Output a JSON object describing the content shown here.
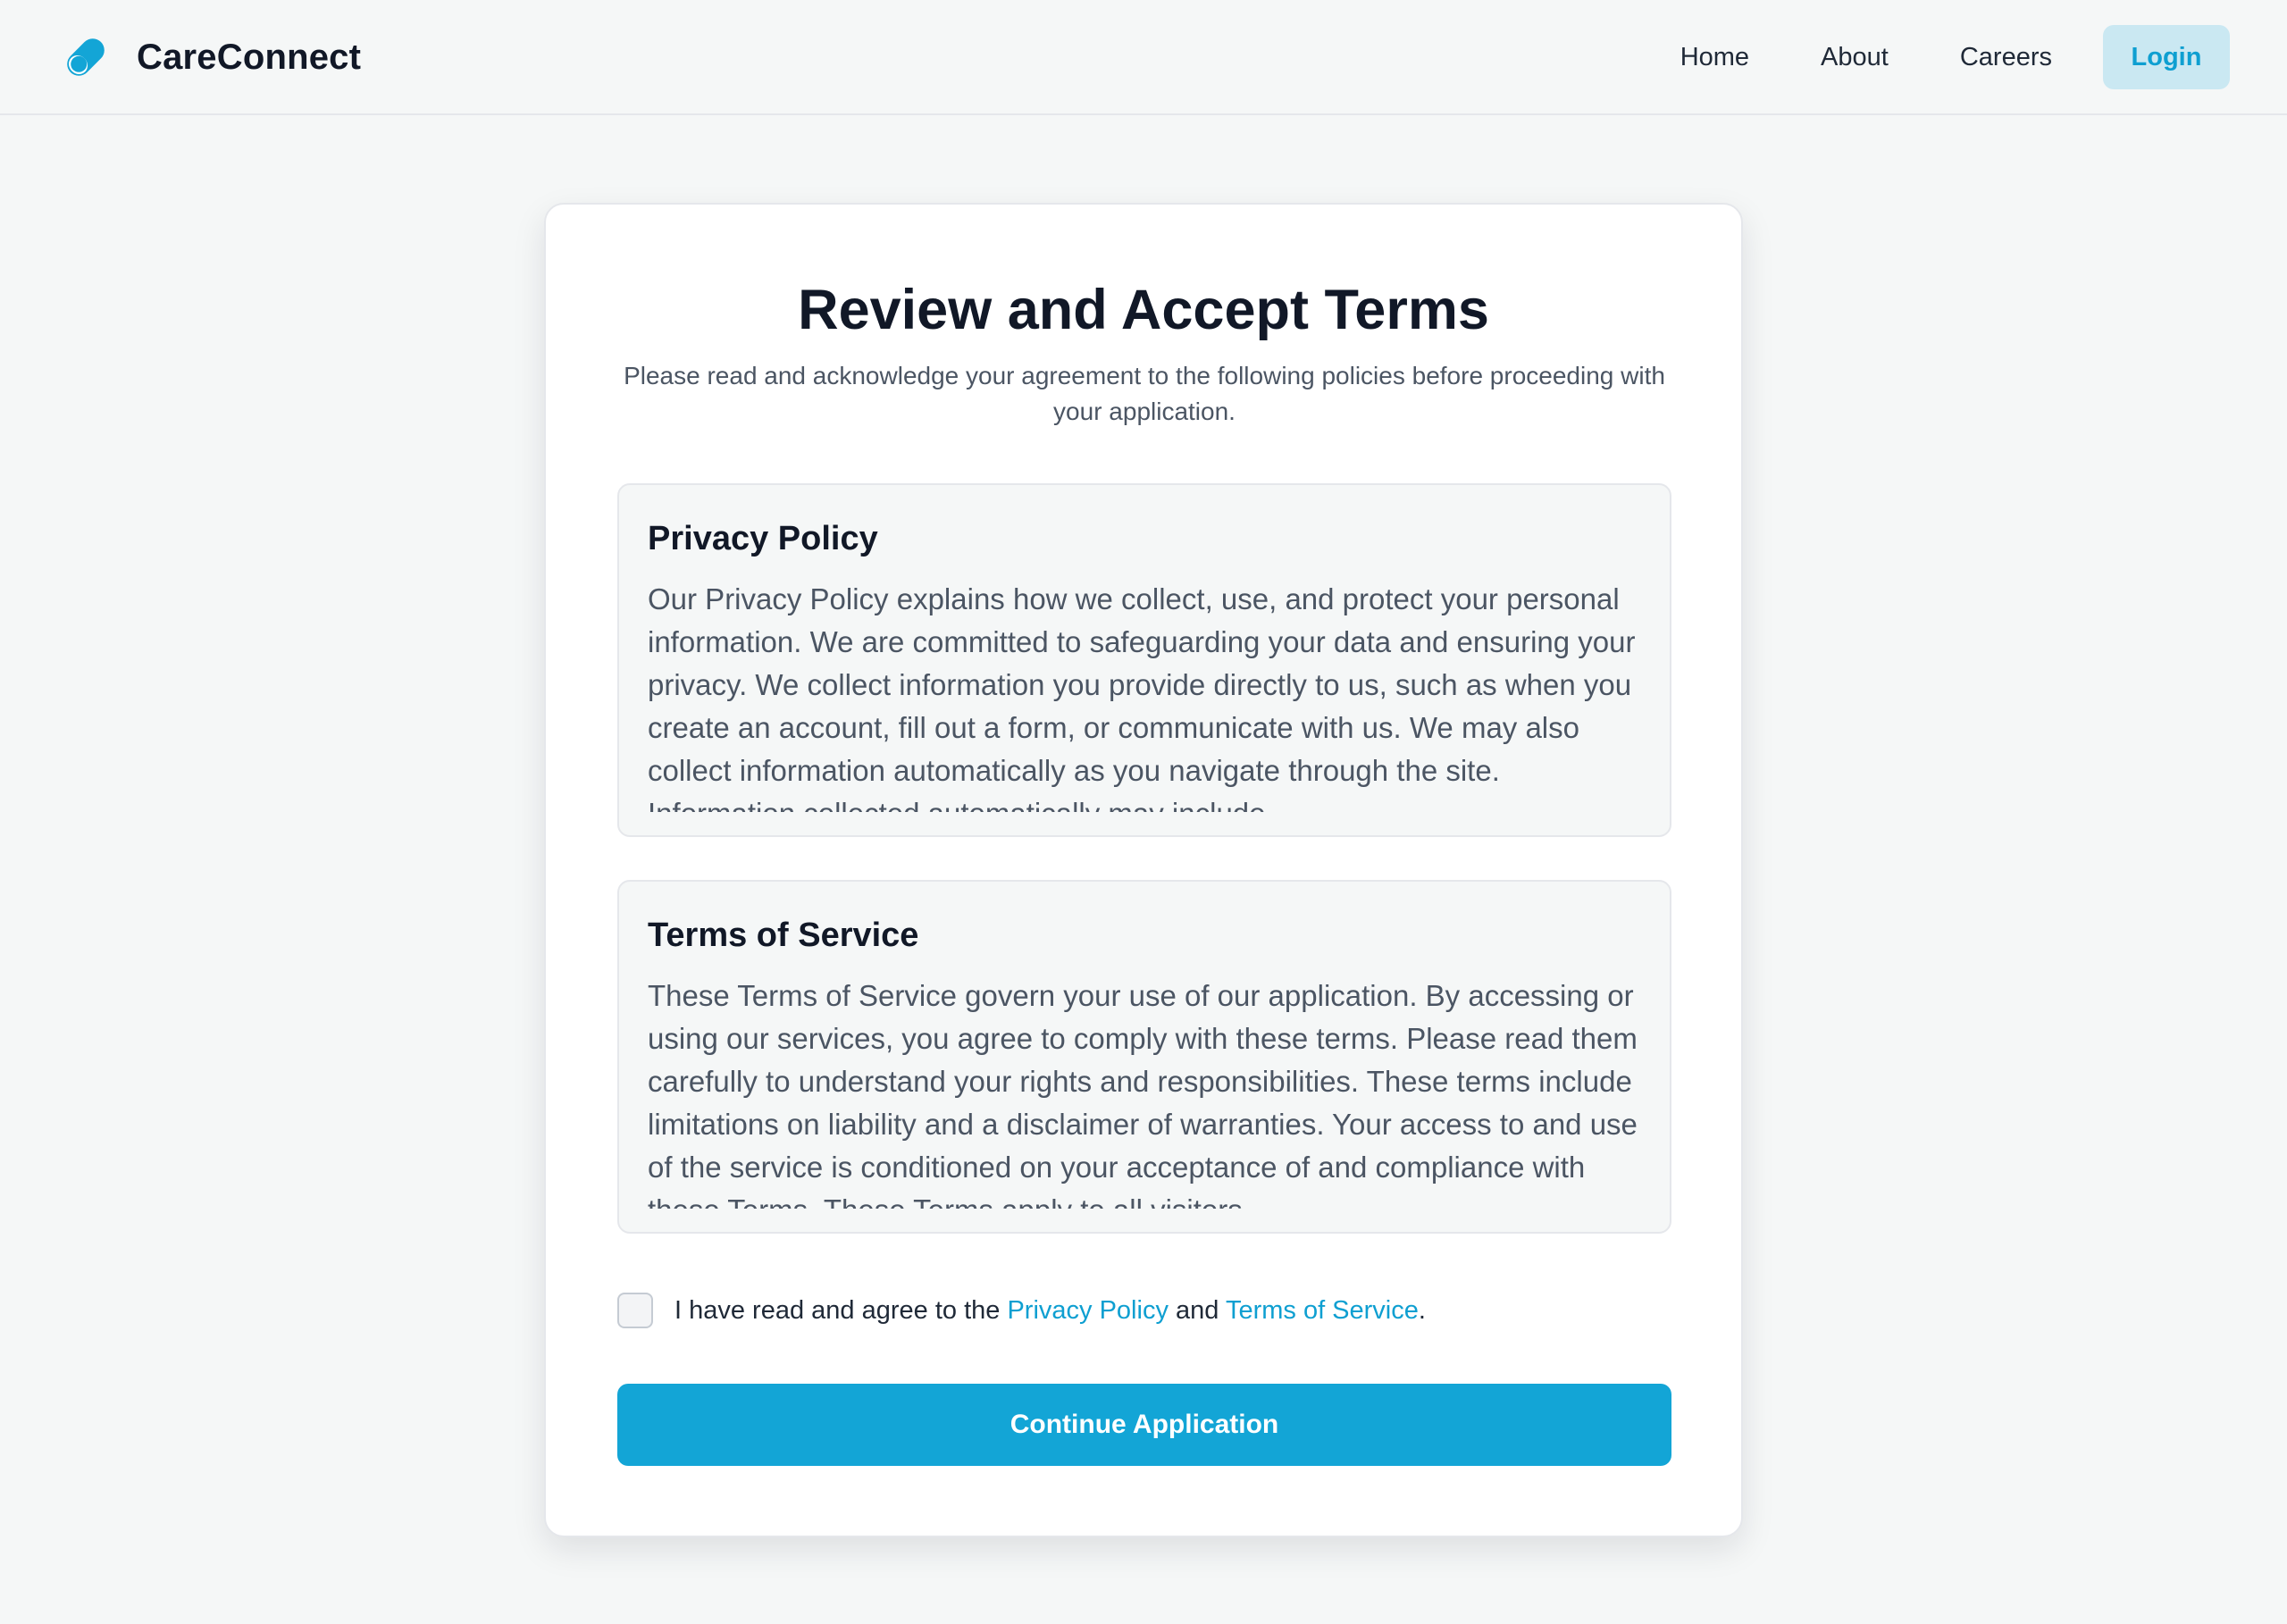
{
  "header": {
    "brand_name": "CareConnect",
    "brand_icon": "pill-logo-icon",
    "nav": [
      "Home",
      "About",
      "Careers"
    ],
    "login_label": "Login"
  },
  "main": {
    "title": "Review and Accept Terms",
    "subtitle": "Please read and acknowledge your agreement to the following policies before proceeding with your application.",
    "privacy": {
      "title": "Privacy Policy",
      "body": "Our Privacy Policy explains how we collect, use, and protect your personal information. We are committed to safeguarding your data and ensuring your privacy. We collect information you provide directly to us, such as when you create an account, fill out a form, or communicate with us. We may also collect information automatically as you navigate through the site. Information collected automatically may include"
    },
    "terms": {
      "title": "Terms of Service",
      "body": "These Terms of Service govern your use of our application. By accessing or using our services, you agree to comply with these terms. Please read them carefully to understand your rights and responsibilities. These terms include limitations on liability and a disclaimer of warranties. Your access to and use of the service is conditioned on your acceptance of and compliance with these Terms. These Terms apply to all visitors"
    },
    "agreement": {
      "checked": false,
      "prefix": "I have read and agree to the ",
      "privacy_link": "Privacy Policy",
      "middle": " and ",
      "terms_link": "Terms of Service",
      "suffix": "."
    },
    "continue_label": "Continue Application"
  },
  "colors": {
    "accent": "#13a5d6",
    "link": "#0e9fd1",
    "login_bg": "#cae8f2",
    "page_bg": "#f5f7f7"
  }
}
